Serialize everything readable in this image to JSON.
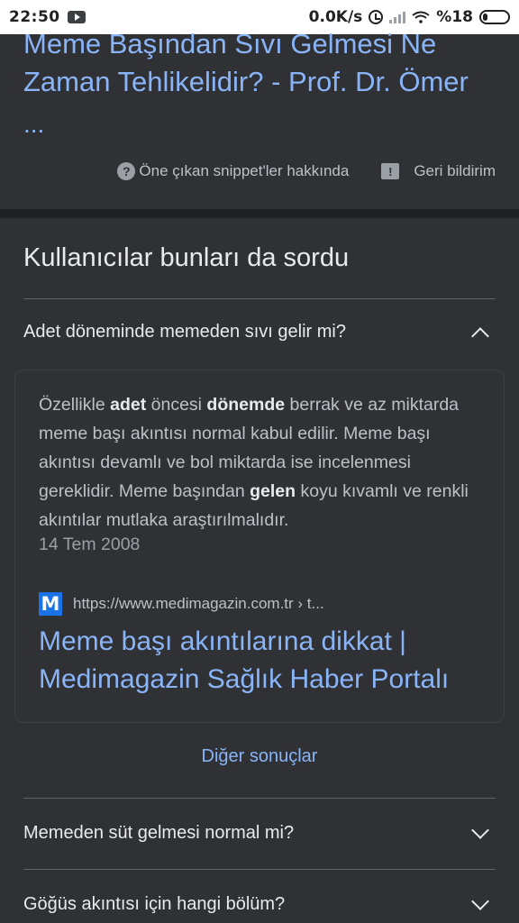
{
  "status_bar": {
    "time": "22:50",
    "network_speed": "0.0K/s",
    "battery": "%18",
    "battery_level": 0.18
  },
  "top_result": {
    "title": "Meme Başından Sıvı Gelmesi Ne Zaman Tehlikelidir? - Prof. Dr. Ömer",
    "ellipsis": "...",
    "about_snippets": "Öne çıkan snippet'ler hakkında",
    "feedback": "Geri bildirim"
  },
  "paa": {
    "title": "Kullanıcılar bunları da sordu",
    "expanded": {
      "question": "Adet döneminde memeden sıvı gelir mi?",
      "answer_parts": [
        {
          "text": "Özellikle ",
          "bold": false
        },
        {
          "text": "adet",
          "bold": true
        },
        {
          "text": " öncesi ",
          "bold": false
        },
        {
          "text": "dönemde",
          "bold": true
        },
        {
          "text": " berrak ve az miktarda meme başı akıntısı normal kabul edilir. Meme başı akıntısı devamlı ve bol miktarda ise incelenmesi gereklidir. Meme başından ",
          "bold": false
        },
        {
          "text": "gelen",
          "bold": true
        },
        {
          "text": " koyu kıvamlı ve renkli akıntılar mutlaka araştırılmalıdır.",
          "bold": false
        }
      ],
      "date": "14 Tem 2008",
      "source_letter": "M",
      "source_url": "https://www.medimagazin.com.tr › t...",
      "source_title": "Meme başı akıntılarına dikkat | Medimagazin Sağlık Haber Portalı"
    },
    "more_results": "Diğer sonuçlar",
    "questions": [
      "Memeden süt gelmesi normal mi?",
      "Göğüs akıntısı için hangi bölüm?"
    ]
  }
}
